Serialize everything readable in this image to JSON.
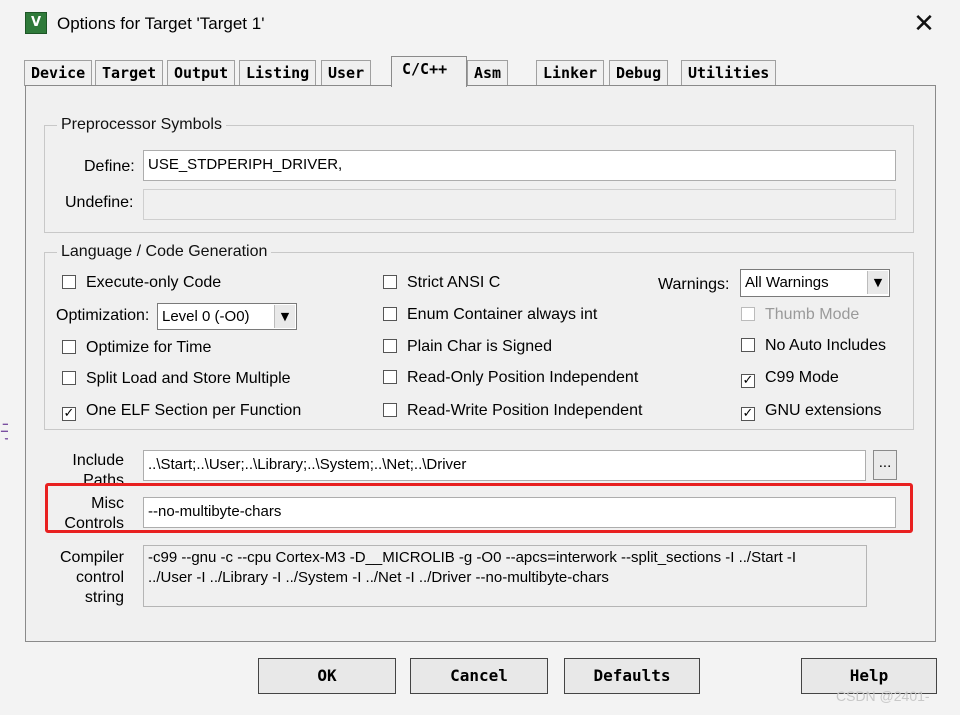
{
  "window": {
    "title": "Options for Target 'Target 1'",
    "app_icon_text": "V",
    "close_glyph": "✕"
  },
  "tabs": [
    {
      "label": "Device"
    },
    {
      "label": "Target"
    },
    {
      "label": "Output"
    },
    {
      "label": "Listing"
    },
    {
      "label": "User"
    },
    {
      "label": "C/C++"
    },
    {
      "label": "Asm"
    },
    {
      "label": "Linker"
    },
    {
      "label": "Debug"
    },
    {
      "label": "Utilities"
    }
  ],
  "active_tab": "C/C++",
  "preprocessor": {
    "legend": "Preprocessor Symbols",
    "define_label": "Define:",
    "define_value": "USE_STDPERIPH_DRIVER,",
    "undefine_label": "Undefine:",
    "undefine_value": ""
  },
  "language": {
    "legend": "Language / Code Generation",
    "execute_only": {
      "label": "Execute-only Code",
      "checked": false
    },
    "optimization_label": "Optimization:",
    "optimization_value": "Level 0 (-O0)",
    "optimize_time": {
      "label": "Optimize for Time",
      "checked": false
    },
    "split_load": {
      "label": "Split Load and Store Multiple",
      "checked": false
    },
    "one_elf": {
      "label": "One ELF Section per Function",
      "checked": true
    },
    "strict_ansi": {
      "label": "Strict ANSI C",
      "checked": false
    },
    "enum_container": {
      "label": "Enum Container always int",
      "checked": false
    },
    "plain_char": {
      "label": "Plain Char is Signed",
      "checked": false
    },
    "ro_pi": {
      "label": "Read-Only Position Independent",
      "checked": false
    },
    "rw_pi": {
      "label": "Read-Write Position Independent",
      "checked": false
    },
    "warnings_label": "Warnings:",
    "warnings_value": "All Warnings",
    "thumb_mode": {
      "label": "Thumb Mode",
      "checked": false,
      "disabled": true
    },
    "no_auto_includes": {
      "label": "No Auto Includes",
      "checked": false
    },
    "c99_mode": {
      "label": "C99 Mode",
      "checked": true
    },
    "gnu_ext": {
      "label": "GNU extensions",
      "checked": true
    }
  },
  "include": {
    "label_line1": "Include",
    "label_line2": "Paths",
    "value": "..\\Start;..\\User;..\\Library;..\\System;..\\Net;..\\Driver",
    "browse": "..."
  },
  "misc": {
    "label_line1": "Misc",
    "label_line2": "Controls",
    "value": "--no-multibyte-chars"
  },
  "compiler": {
    "label_line1": "Compiler",
    "label_line2": "control",
    "label_line3": "string",
    "line1": "-c99 --gnu -c --cpu Cortex-M3 -D__MICROLIB -g -O0 --apcs=interwork --split_sections -I ../Start -I",
    "line2": "../User -I ../Library -I ../System -I ../Net -I ../Driver --no-multibyte-chars"
  },
  "buttons": {
    "ok": "OK",
    "cancel": "Cancel",
    "defaults": "Defaults",
    "help": "Help"
  },
  "checkmark_glyph": "✓",
  "dropdown_glyph": "▼",
  "watermark": "CSDN @2401-",
  "colors": {
    "highlight_box": "#e82020",
    "icon_green": "#2f7a3a"
  }
}
